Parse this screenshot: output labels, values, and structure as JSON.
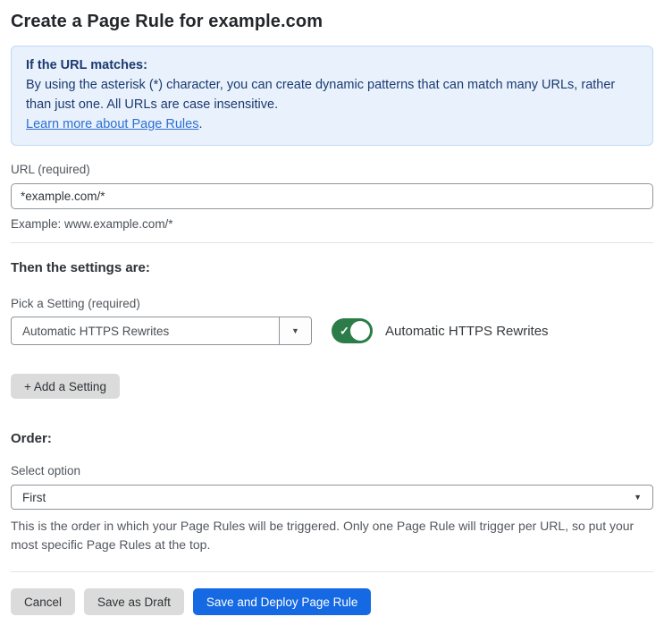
{
  "page": {
    "title": "Create a Page Rule for example.com"
  },
  "info_box": {
    "heading": "If the URL matches:",
    "body": "By using the asterisk (*) character, you can create dynamic patterns that can match many URLs, rather than just one. All URLs are case insensitive.",
    "link_label": "Learn more about Page Rules",
    "link_suffix": "."
  },
  "url_field": {
    "label": "URL (required)",
    "value": "*example.com/*",
    "helper": "Example: www.example.com/*"
  },
  "settings_section": {
    "heading": "Then the settings are:",
    "picker_label": "Pick a Setting (required)",
    "picker_value": "Automatic HTTPS Rewrites",
    "dropdown_arrow": "▼",
    "toggle_state": "on",
    "toggle_check": "✓",
    "toggle_label": "Automatic HTTPS Rewrites",
    "add_setting_button": "+ Add a Setting"
  },
  "order_section": {
    "heading": "Order:",
    "select_label": "Select option",
    "select_value": "First",
    "select_arrow": "▼",
    "helper": "This is the order in which your Page Rules will be triggered. Only one Page Rule will trigger per URL, so put your most specific Page Rules at the top."
  },
  "footer": {
    "cancel_label": "Cancel",
    "save_draft_label": "Save as Draft",
    "save_deploy_label": "Save and Deploy Page Rule"
  },
  "colors": {
    "info_background": "#e9f2fc",
    "info_border": "#bed8f3",
    "info_text": "#1b3a70",
    "link_blue": "#2d6fd2",
    "toggle_green": "#2b7c48",
    "primary_button_blue": "#1569e2",
    "secondary_button_gray": "#dbdbdb"
  }
}
